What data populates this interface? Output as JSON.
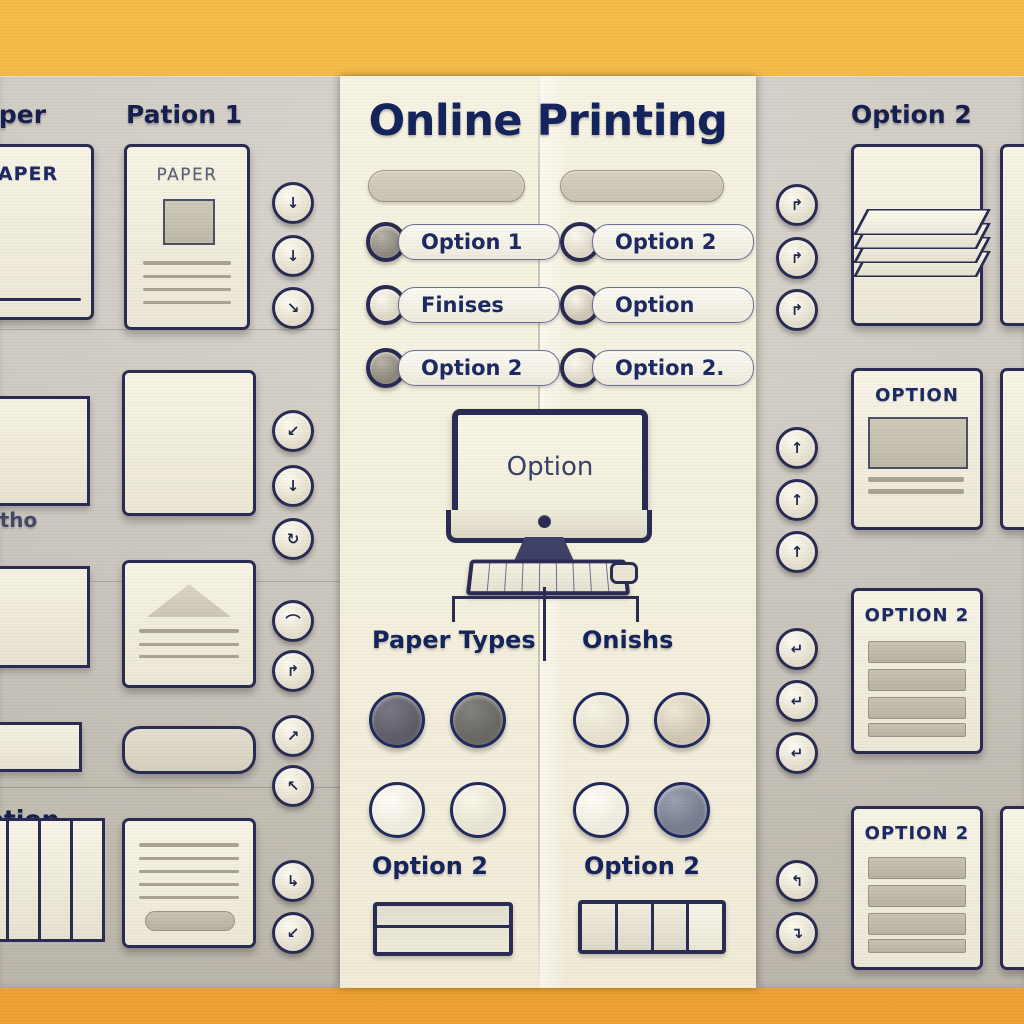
{
  "colors": {
    "backdrop_orange": "#f3b03c",
    "board_gray": "#cdc8be",
    "panel_cream": "#f4f0de",
    "ink_navy": "#16245e",
    "outline_navy": "#2b2c54"
  },
  "center_panel": {
    "title": "Online Printing",
    "inputs": [
      {
        "name": "left-search-bar",
        "value": "",
        "placeholder": ""
      },
      {
        "name": "right-search-bar",
        "value": "",
        "placeholder": ""
      }
    ],
    "options_left": [
      {
        "label": "Option 1",
        "selected": true
      },
      {
        "label": "Finises",
        "selected": false
      },
      {
        "label": "Option 2",
        "selected": true
      }
    ],
    "options_right": [
      {
        "label": "Option 2",
        "selected": false
      },
      {
        "label": "Option",
        "selected": false
      },
      {
        "label": "Option 2.",
        "selected": false
      }
    ],
    "monitor": {
      "screen_text": "Option"
    },
    "sections": [
      {
        "heading": "Paper Types",
        "swatches": [
          "#6b6a74",
          "#76746f",
          "#faf7ec",
          "#f6f2e4"
        ],
        "footer_label": "Option 2"
      },
      {
        "heading": "Onishs",
        "swatches": [
          "#f2eddc",
          "#ded6c2",
          "#faf8ef",
          "#8a93a6"
        ],
        "footer_label": "Option 2"
      }
    ]
  },
  "left_board": {
    "headings": [
      {
        "text": "aper"
      },
      {
        "text": "Pation 1"
      },
      {
        "text": "otho"
      },
      {
        "text": "ption"
      }
    ],
    "cards": [
      {
        "title": "APER"
      },
      {
        "title": "PAPER"
      },
      {
        "title": ""
      },
      {
        "title": ""
      },
      {
        "title": ""
      }
    ],
    "buttons": [
      {
        "glyph": "↓"
      },
      {
        "glyph": "↓"
      },
      {
        "glyph": "↘"
      },
      {
        "glyph": "↙"
      },
      {
        "glyph": "↓"
      },
      {
        "glyph": "↻"
      },
      {
        "glyph": "⌒"
      },
      {
        "glyph": "↱"
      },
      {
        "glyph": "↗"
      },
      {
        "glyph": "↖"
      },
      {
        "glyph": "↳"
      },
      {
        "glyph": "↙"
      }
    ]
  },
  "right_board": {
    "headings": [
      {
        "text": "Option 2"
      }
    ],
    "cards": [
      {
        "title": ""
      },
      {
        "title": "OPTION"
      },
      {
        "title": "OPTION 2"
      }
    ],
    "buttons": [
      {
        "glyph": "↱"
      },
      {
        "glyph": "↱"
      },
      {
        "glyph": "↱"
      },
      {
        "glyph": "↑"
      },
      {
        "glyph": "↑"
      },
      {
        "glyph": "↑"
      },
      {
        "glyph": "↵"
      },
      {
        "glyph": "↵"
      },
      {
        "glyph": "↵"
      },
      {
        "glyph": "↰"
      },
      {
        "glyph": "↴"
      }
    ]
  }
}
